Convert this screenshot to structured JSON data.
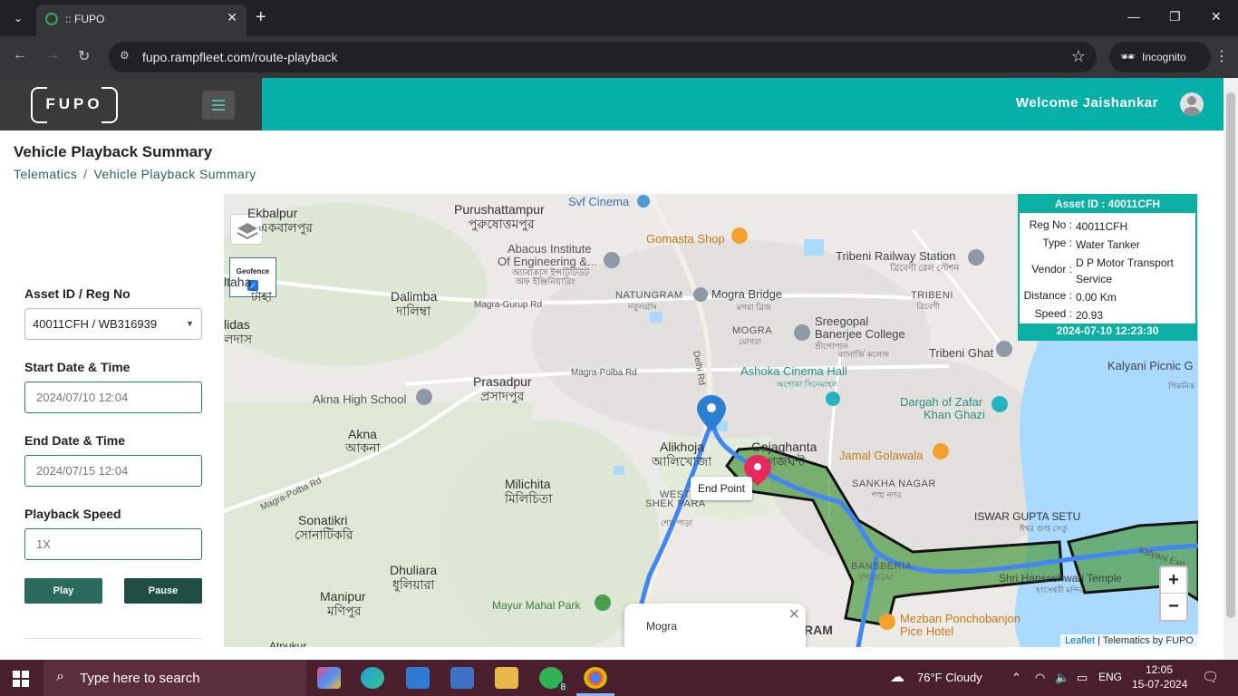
{
  "browser": {
    "tab_title": ":: FUPO",
    "url": "fupo.rampfleet.com/route-playback",
    "incognito_label": "Incognito"
  },
  "header": {
    "logo_text": "FUPO",
    "welcome": "Welcome Jaishankar"
  },
  "page": {
    "title": "Vehicle Playback Summary",
    "breadcrumb": [
      "Telematics",
      "Vehicle Playback Summary"
    ]
  },
  "form": {
    "asset_label": "Asset ID / Reg No",
    "asset_value": "40011CFH / WB316939",
    "start_label": "Start Date & Time",
    "start_value": "2024/07/10 12:04",
    "end_label": "End Date & Time",
    "end_value": "2024/07/15 12:04",
    "speed_label": "Playback Speed",
    "speed_value": "1X",
    "play_label": "Play",
    "pause_label": "Pause"
  },
  "map": {
    "geofence_label": "Geofence",
    "endpoint_label": "End Point",
    "popup_text": "Mogra",
    "attribution_link": "Leaflet",
    "attribution_text": "| Telematics by FUPO",
    "zoom_in": "+",
    "zoom_out": "−",
    "labels": {
      "ekbalpur": "Ekbalpur",
      "ekbalpur_bn": "একবালপুর",
      "purushattampur": "Purushattampur",
      "purushattampur_bn": "পুরুষোত্তমপুর",
      "svf": "Svf Cinema",
      "gomasta": "Gomasta Shop",
      "abacus1": "Abacus Institute",
      "abacus2": "Of Engineering &...",
      "abacus_bn1": "অ্যাবাকাস ইন্সটিটিউট",
      "abacus_bn2": "অফ ইঞ্জিনিয়ারিং",
      "tribeni_station": "Tribeni Railway Station",
      "tribeni_station_bn": "ত্রিবেণী রেল স্টেশন",
      "natungram": "NATUNGRAM",
      "natungram_bn": "নতুনগ্রাম",
      "mogra_bridge": "Mogra Bridge",
      "mogra_bridge_bn": "মগরা ব্রিজ",
      "tribeni": "TRIBENI",
      "tribeni_bn": "ত্রিবেণী",
      "mogra": "MOGRA",
      "mogra_bn": "মোগরা",
      "sreegopal1": "Sreegopal",
      "sreegopal2": "Banerjee College",
      "sreegopal_bn1": "শ্রীগোপাল",
      "sreegopal_bn2": "ব্যানার্জি কলেজ",
      "tribeni_ghat": "Tribeni Ghat",
      "kalyani": "Kalyani Picnic G",
      "kalyani_bn": "পিকনিক",
      "dalimba": "Dalimba",
      "dalimba_bn": "দালিম্বা",
      "lidas": "lidas",
      "lidas_bn": "লদাস",
      "itaha": "ltaha",
      "itaha_bn": "টাহা",
      "magra_gurup": "Magra-Gurup Rd",
      "magra_polba": "Magra-Polba Rd",
      "delhi_rd": "Delhi Rd",
      "ashoka": "Ashoka Cinema Hall",
      "ashoka_bn": "অশোকা সিনেমাহল",
      "prasadpur": "Prasadpur",
      "prasadpur_bn": "প্রসাদপুর",
      "akna_school": "Akna High School",
      "dargah1": "Dargah of Zafar",
      "dargah2": "Khan Ghazi",
      "akna": "Akna",
      "akna_bn": "আকনা",
      "alikhoja": "Alikhoja",
      "alikhoja_bn": "আলিখোজা",
      "gajaghanta": "Gajaghanta",
      "gajaghanta_bn": "গজঘন্ট",
      "jamal": "Jamal Golawala",
      "sankha": "SANKHA NAGAR",
      "sankha_bn": "শঙ্খ নগর",
      "magra_polba2": "Magra-Polba Rd",
      "west_shek": "WEST",
      "shek_para": "SHEK PARA",
      "shek_bn": "শেখ পাড়া",
      "milichita": "Milichita",
      "milichita_bn": "মিলিচিতা",
      "iswar": "ISWAR GUPTA SETU",
      "iswar_bn": "ঈশ্বর গুপ্ত সেতু",
      "sonatikri": "Sonatikri",
      "sonatikri_bn": "সোনাটিকরি",
      "bansberia": "BANSBERIA",
      "bansberia_bn": "বাঁশবেড়িয়া",
      "hanseshwari": "Shri Hanseshwari Temple",
      "hanseshwari_bn": "হংসেশ্বরী মন্দির",
      "kalyani_exp": "Kalyani Exp",
      "dhuliara": "Dhuliara",
      "dhuliara_bn": "ধুলিয়ারা",
      "mayur": "Mayur Mahal Park",
      "manipur": "Manipur",
      "manipur_bn": "মণিপুর",
      "mezban1": "Mezban Ponchobanjon",
      "mezban2": "Pice Hotel",
      "ram": "RAM",
      "atpukur": "Atpukur"
    }
  },
  "info": {
    "title": "Asset ID : 40011CFH",
    "reg_label": "Reg No :",
    "reg_value": "40011CFH",
    "type_label": "Type :",
    "type_value": "Water Tanker",
    "vendor_label": "Vendor :",
    "vendor_value": "D P Motor Transport Service",
    "distance_label": "Distance :",
    "distance_value": "0.00 Km",
    "speed_label": "Speed :",
    "speed_value": "20.93",
    "timestamp": "2024-07-10 12:23:30"
  },
  "taskbar": {
    "search_placeholder": "Type here to search",
    "weather": "76°F  Cloudy",
    "lang": "ENG",
    "time": "12:05",
    "date": "15-07-2024",
    "whatsapp_badge": "8",
    "notif_count": "1"
  },
  "colors": {
    "accent": "#06b0a8",
    "button_dark": "#235e55",
    "geofence_fill": "#5c9e4e",
    "route_blue": "#4285f4"
  }
}
